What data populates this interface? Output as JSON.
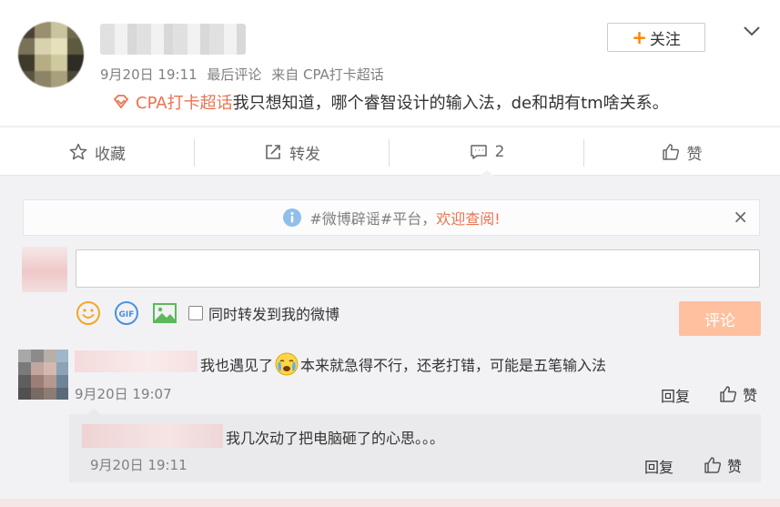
{
  "post": {
    "meta": {
      "date": "9月20日 19:11",
      "last_comment": "最后评论",
      "source": "来自 CPA打卡超话"
    },
    "follow_label": "关注",
    "topic": "CPA打卡超话",
    "text": "我只想知道，哪个睿智设计的输入法，de和胡有tm啥关系。"
  },
  "actions": {
    "favorite": "收藏",
    "repost": "转发",
    "comment_count": "2",
    "like": "赞"
  },
  "notice": {
    "prefix": "#微博辟谣#平台，",
    "highlight": "欢迎查阅!"
  },
  "composer": {
    "input_value": "",
    "repost_label": "同时转发到我的微博",
    "submit_label": "评论"
  },
  "comments": [
    {
      "text_before": "我也遇见了",
      "text_after": "本来就急得不行，还老打错，可能是五笔输入法",
      "time": "9月20日 19:07",
      "reply_label": "回复",
      "like_label": "赞"
    },
    {
      "text": "我几次动了把电脑砸了的心思。。。",
      "time": "9月20日 19:11",
      "reply_label": "回复",
      "like_label": "赞"
    }
  ],
  "colors": {
    "accent": "#eb7350",
    "follow_plus": "#ff8200",
    "submit_disabled": "#ffc09f"
  },
  "icons": [
    "topic-diamond-icon",
    "star-icon",
    "repost-icon",
    "comment-icon",
    "thumb-up-icon",
    "info-icon",
    "close-icon",
    "emoji-icon",
    "gif-icon",
    "image-icon",
    "chevron-down-icon",
    "cry-emoji-icon"
  ]
}
